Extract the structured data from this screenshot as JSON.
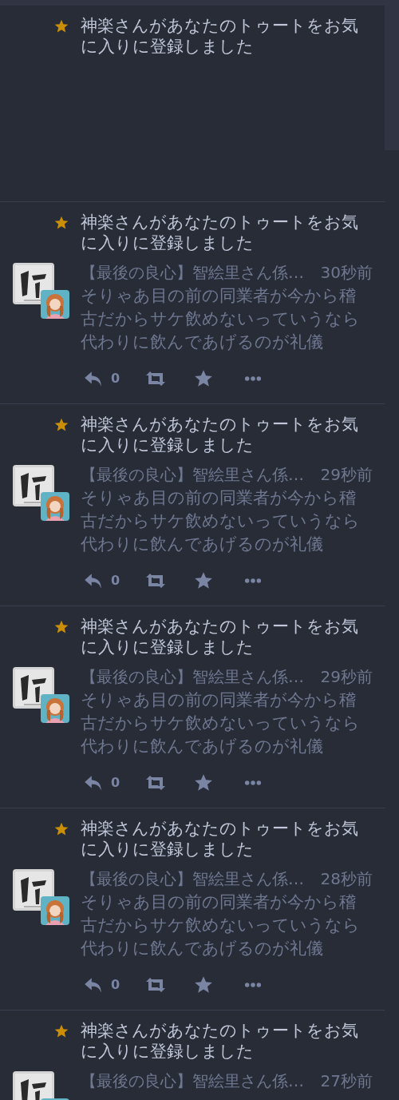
{
  "notifications": [
    {
      "message": "神楽さんがあなたのトゥートをお気に入りに登録しました"
    },
    {
      "message": "神楽さんがあなたのトゥートをお気に入りに登録しました",
      "status": {
        "display_name": "【最後の良心】智絵里さん係…",
        "time": "30秒前",
        "content": "そりゃあ目の前の同業者が今から稽古だからサケ飲めないっていうなら代わりに飲んであげるのが礼儀",
        "reply_count": "0"
      }
    },
    {
      "message": "神楽さんがあなたのトゥートをお気に入りに登録しました",
      "status": {
        "display_name": "【最後の良心】智絵里さん係…",
        "time": "29秒前",
        "content": "そりゃあ目の前の同業者が今から稽古だからサケ飲めないっていうなら代わりに飲んであげるのが礼儀",
        "reply_count": "0"
      }
    },
    {
      "message": "神楽さんがあなたのトゥートをお気に入りに登録しました",
      "status": {
        "display_name": "【最後の良心】智絵里さん係…",
        "time": "29秒前",
        "content": "そりゃあ目の前の同業者が今から稽古だからサケ飲めないっていうなら代わりに飲んであげるのが礼儀",
        "reply_count": "0"
      }
    },
    {
      "message": "神楽さんがあなたのトゥートをお気に入りに登録しました",
      "status": {
        "display_name": "【最後の良心】智絵里さん係…",
        "time": "28秒前",
        "content": "そりゃあ目の前の同業者が今から稽古だからサケ飲めないっていうなら代わりに飲んであげるのが礼儀",
        "reply_count": "0"
      }
    },
    {
      "message": "神楽さんがあなたのトゥートをお気に入りに登録しました",
      "status": {
        "display_name": "【最後の良心】智絵里さん係…",
        "time": "27秒前"
      }
    }
  ]
}
